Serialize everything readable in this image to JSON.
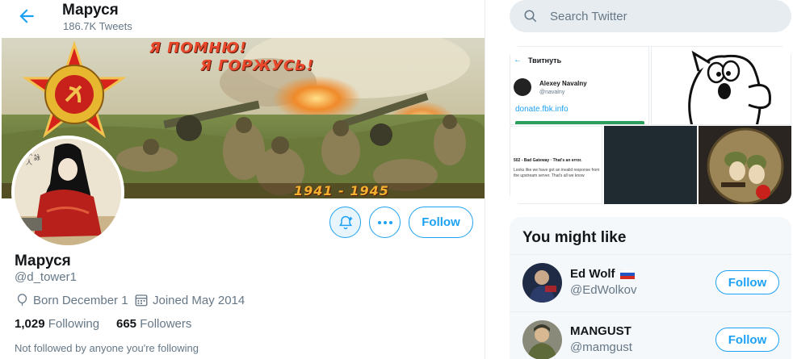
{
  "header": {
    "title": "Маруся",
    "tweet_count": "186.7K Tweets"
  },
  "banner": {
    "line1": "Я ПОМНЮ!",
    "line2": "Я ГОРЖУСЬ!",
    "years": "1941 - 1945"
  },
  "profile": {
    "name": "Маруся",
    "handle": "@d_tower1",
    "born": "Born December 1",
    "joined": "Joined May 2014",
    "following_count": "1,029",
    "following_label": "Following",
    "followers_count": "665",
    "followers_label": "Followers",
    "not_followed": "Not followed by anyone you're following",
    "follow_label": "Follow"
  },
  "search": {
    "placeholder": "Search Twitter"
  },
  "media": {
    "tile1": {
      "header": "Твитнуть",
      "name": "Alexey Navalny",
      "handle": "@navalny",
      "link": "donate.fbk.info"
    },
    "tile3": {
      "title": "502 - Bad Gateway · That's an error.",
      "body": "Looks like we have got an invalid response from the upstream server. That's all we know"
    }
  },
  "who_to_follow": {
    "title": "You might like",
    "follow_label": "Follow",
    "users": [
      {
        "name": "Ed Wolf",
        "handle": "@EdWolkov"
      },
      {
        "name": "MANGUST",
        "handle": "@mamgust"
      }
    ]
  },
  "colors": {
    "accent": "#1da1f2",
    "text": "#14171a",
    "muted": "#657786",
    "border": "#e6ecf0"
  }
}
